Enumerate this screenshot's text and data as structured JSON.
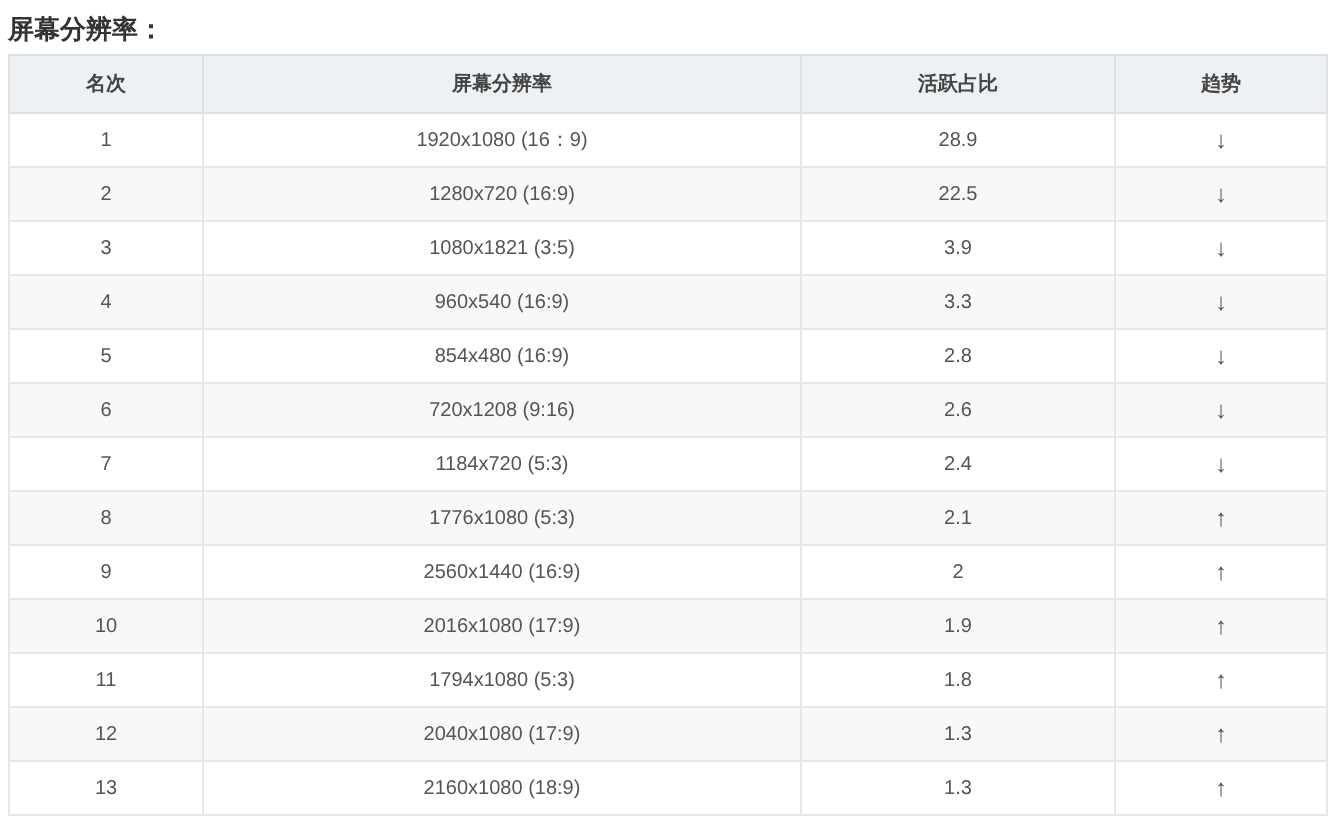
{
  "title": "屏幕分辨率：",
  "table": {
    "columns": [
      "名次",
      "屏幕分辨率",
      "活跃占比",
      "趋势"
    ],
    "rows": [
      [
        "1",
        "1920x1080 (16：9)",
        "28.9",
        "↓"
      ],
      [
        "2",
        "1280x720 (16:9)",
        "22.5",
        "↓"
      ],
      [
        "3",
        "1080x1821 (3:5)",
        "3.9",
        "↓"
      ],
      [
        "4",
        "960x540 (16:9)",
        "3.3",
        "↓"
      ],
      [
        "5",
        "854x480 (16:9)",
        "2.8",
        "↓"
      ],
      [
        "6",
        "720x1208 (9:16)",
        "2.6",
        "↓"
      ],
      [
        "7",
        "1184x720 (5:3)",
        "2.4",
        "↓"
      ],
      [
        "8",
        "1776x1080 (5:3)",
        "2.1",
        "↑"
      ],
      [
        "9",
        "2560x1440 (16:9)",
        "2",
        "↑"
      ],
      [
        "10",
        "2016x1080 (17:9)",
        "1.9",
        "↑"
      ],
      [
        "11",
        "1794x1080 (5:3)",
        "1.8",
        "↑"
      ],
      [
        "12",
        "2040x1080 (17:9)",
        "1.3",
        "↑"
      ],
      [
        "13",
        "2160x1080 (18:9)",
        "1.3",
        "↑"
      ]
    ]
  }
}
